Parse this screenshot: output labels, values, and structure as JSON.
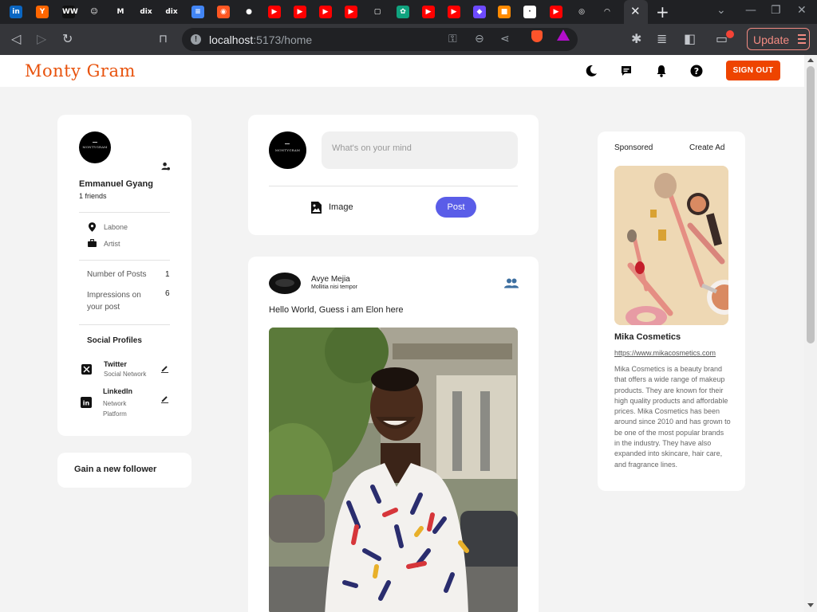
{
  "browser": {
    "tab_favicons": [
      {
        "name": "linkedin",
        "glyph": "in",
        "color": "#0a66c2"
      },
      {
        "name": "ycombinator",
        "glyph": "Y",
        "color": "#ff6600"
      },
      {
        "name": "www",
        "glyph": "WW",
        "color": "#111111"
      },
      {
        "name": "smiley",
        "glyph": "☺",
        "color": "#202124"
      },
      {
        "name": "gmail",
        "glyph": "M",
        "color": "#202124"
      },
      {
        "name": "dix",
        "glyph": "dix",
        "color": "#202124"
      },
      {
        "name": "dix2",
        "glyph": "dix",
        "color": "#202124"
      },
      {
        "name": "docs",
        "glyph": "≡",
        "color": "#4285f4"
      },
      {
        "name": "app-orange",
        "glyph": "◉",
        "color": "#ff5722"
      },
      {
        "name": "github",
        "glyph": "●",
        "color": "#202124"
      },
      {
        "name": "youtube",
        "glyph": "▶",
        "color": "#ff0000"
      },
      {
        "name": "youtube",
        "glyph": "▶",
        "color": "#ff0000"
      },
      {
        "name": "youtube",
        "glyph": "▶",
        "color": "#ff0000"
      },
      {
        "name": "youtube",
        "glyph": "▶",
        "color": "#ff0000"
      },
      {
        "name": "frame",
        "glyph": "▢",
        "color": "#202124"
      },
      {
        "name": "chatgpt",
        "glyph": "✿",
        "color": "#10a37f"
      },
      {
        "name": "youtube",
        "glyph": "▶",
        "color": "#ff0000"
      },
      {
        "name": "youtube",
        "glyph": "▶",
        "color": "#ff0000"
      },
      {
        "name": "proton",
        "glyph": "◆",
        "color": "#6d4aff"
      },
      {
        "name": "cube",
        "glyph": "■",
        "color": "#ff8a00"
      },
      {
        "name": "blank",
        "glyph": "·",
        "color": "#ffffff"
      },
      {
        "name": "youtube",
        "glyph": "▶",
        "color": "#ff0000"
      },
      {
        "name": "ring",
        "glyph": "◎",
        "color": "#202124"
      },
      {
        "name": "gauge",
        "glyph": "◠",
        "color": "#202124"
      }
    ],
    "url_host": "localhost",
    "url_rest": ":5173/home",
    "update_label": "Update"
  },
  "app": {
    "logo": "Monty Gram",
    "signout_label": "SIGN OUT",
    "accent": "#ee4400",
    "post_button_color": "#5a5de8"
  },
  "profile": {
    "avatar_text": "MONTYGRAM",
    "name": "Emmanuel Gyang",
    "friends": "1 friends",
    "location": "Labone",
    "occupation": "Artist",
    "stats": [
      {
        "label": "Number of Posts",
        "value": "1"
      },
      {
        "label": "Impressions on your post",
        "value": "6"
      }
    ],
    "social_title": "Social Profiles",
    "socials": [
      {
        "name": "Twitter",
        "type": "Social Network"
      },
      {
        "name": "LinkedIn",
        "type": "Network Platform"
      }
    ]
  },
  "follower_card": {
    "title": "Gain a new follower"
  },
  "composer": {
    "avatar_text": "MONTYGRAM",
    "placeholder": "What's on your mind",
    "image_label": "Image",
    "post_label": "Post"
  },
  "post": {
    "author": "Avye Mejia",
    "subtitle": "Mollitia nisi tempor",
    "caption": "Hello World, Guess i am Elon here"
  },
  "ad": {
    "sponsored": "Sponsored",
    "create_ad": "Create Ad",
    "brand": "Mika Cosmetics",
    "url": "https://www.mikacosmetics.com",
    "description": "Mika Cosmetics is a beauty brand that offers a wide range of makeup products. They are known for their high quality products and affordable prices. Mika Cosmetics has been around since 2010 and has grown to be one of the most popular brands in the industry. They have also expanded into skincare, hair care, and fragrance lines."
  }
}
